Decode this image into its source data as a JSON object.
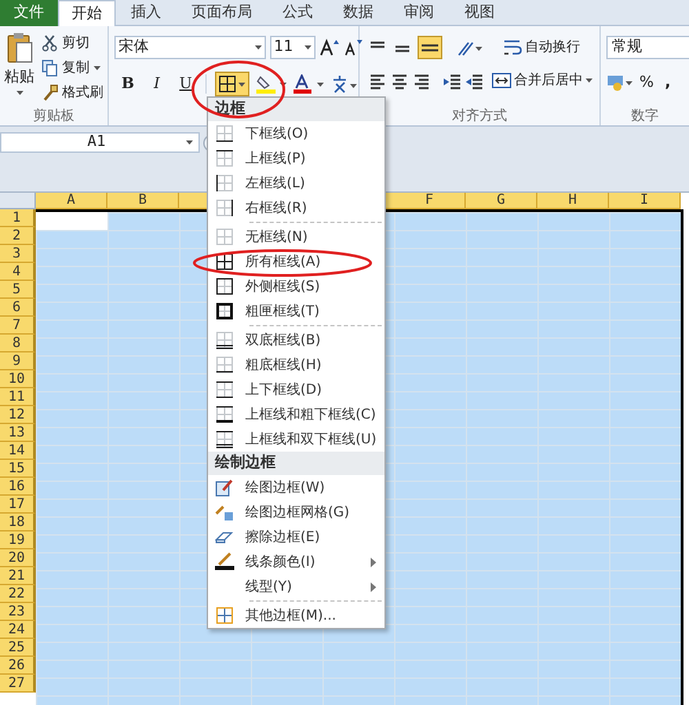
{
  "tabs": [
    {
      "label": "文件",
      "kind": "file",
      "selected": false
    },
    {
      "label": "开始",
      "kind": "tab",
      "selected": true
    },
    {
      "label": "插入",
      "kind": "tab",
      "selected": false
    },
    {
      "label": "页面布局",
      "kind": "tab",
      "selected": false
    },
    {
      "label": "公式",
      "kind": "tab",
      "selected": false
    },
    {
      "label": "数据",
      "kind": "tab",
      "selected": false
    },
    {
      "label": "审阅",
      "kind": "tab",
      "selected": false
    },
    {
      "label": "视图",
      "kind": "tab",
      "selected": false
    }
  ],
  "clipboard": {
    "paste": "粘贴",
    "items": [
      "剪切",
      "复制",
      "格式刷"
    ],
    "label": "剪贴板"
  },
  "font": {
    "name": "宋体",
    "size": "11",
    "bold": "B",
    "italic": "I",
    "underline": "U",
    "borders_active": true
  },
  "alignment": {
    "wrap": "自动换行",
    "merge": "合并后居中",
    "label": "对齐方式",
    "bottom_align_active": true
  },
  "number": {
    "format": "常规",
    "percent": "%",
    "comma": ",",
    "label": "数字"
  },
  "name_box": "A1",
  "columns_left": [
    "A",
    "B"
  ],
  "columns_right": [
    "F",
    "G",
    "H",
    "I"
  ],
  "rows": [
    "1",
    "2",
    "3",
    "4",
    "5",
    "6",
    "7",
    "8",
    "9",
    "10",
    "11",
    "12",
    "13",
    "14",
    "15",
    "16",
    "17",
    "18",
    "19",
    "20",
    "21",
    "22",
    "23",
    "24",
    "25",
    "26",
    "27"
  ],
  "menu": [
    {
      "kind": "header",
      "label": "边框"
    },
    {
      "kind": "item",
      "label": "下框线(O)",
      "submenu": false
    },
    {
      "kind": "item",
      "label": "上框线(P)",
      "submenu": false
    },
    {
      "kind": "item",
      "label": "左框线(L)",
      "submenu": false
    },
    {
      "kind": "item",
      "label": "右框线(R)",
      "submenu": false
    },
    {
      "kind": "separator"
    },
    {
      "kind": "item",
      "label": "无框线(N)",
      "submenu": false
    },
    {
      "kind": "item",
      "label": "所有框线(A)",
      "submenu": false
    },
    {
      "kind": "item",
      "label": "外侧框线(S)",
      "submenu": false
    },
    {
      "kind": "item",
      "label": "粗匣框线(T)",
      "submenu": false
    },
    {
      "kind": "separator"
    },
    {
      "kind": "item",
      "label": "双底框线(B)",
      "submenu": false
    },
    {
      "kind": "item",
      "label": "粗底框线(H)",
      "submenu": false
    },
    {
      "kind": "item",
      "label": "上下框线(D)",
      "submenu": false
    },
    {
      "kind": "item",
      "label": "上框线和粗下框线(C)",
      "submenu": false
    },
    {
      "kind": "item",
      "label": "上框线和双下框线(U)",
      "submenu": false
    },
    {
      "kind": "header",
      "label": "绘制边框"
    },
    {
      "kind": "item",
      "label": "绘图边框(W)",
      "submenu": false
    },
    {
      "kind": "item",
      "label": "绘图边框网格(G)",
      "submenu": false
    },
    {
      "kind": "item",
      "label": "擦除边框(E)",
      "submenu": false
    },
    {
      "kind": "item",
      "label": "线条颜色(I)",
      "submenu": true
    },
    {
      "kind": "item",
      "label": "线型(Y)",
      "submenu": true
    },
    {
      "kind": "separator"
    },
    {
      "kind": "item",
      "label": "其他边框(M)...",
      "submenu": false
    }
  ]
}
